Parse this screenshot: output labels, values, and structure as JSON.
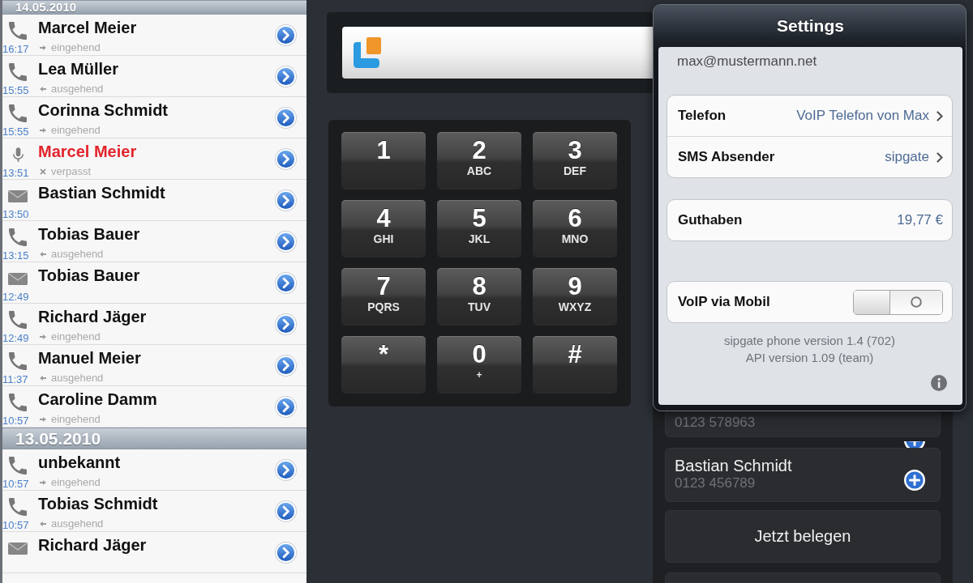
{
  "call_log": {
    "sections": [
      {
        "date": "14.05.2010",
        "entries": [
          {
            "kind": "call",
            "name": "Marcel Meier",
            "time": "16:17",
            "status": {
              "kind": "incoming",
              "text": "eingehend"
            }
          },
          {
            "kind": "call",
            "name": "Lea Müller",
            "time": "15:55",
            "status": {
              "kind": "outgoing",
              "text": "ausgehend"
            }
          },
          {
            "kind": "call",
            "name": "Corinna Schmidt",
            "time": "15:55",
            "status": {
              "kind": "incoming",
              "text": "eingehend"
            }
          },
          {
            "kind": "voicemail",
            "name": "Marcel Meier",
            "time": "13:51",
            "status": {
              "kind": "missed",
              "text": "verpasst"
            }
          },
          {
            "kind": "sms",
            "name": "Bastian Schmidt",
            "time": "13:50"
          },
          {
            "kind": "call",
            "name": "Tobias Bauer",
            "time": "13:15",
            "status": {
              "kind": "outgoing",
              "text": "ausgehend"
            }
          },
          {
            "kind": "sms",
            "name": "Tobias Bauer",
            "time": "12:49"
          },
          {
            "kind": "call",
            "name": "Richard Jäger",
            "time": "12:49",
            "status": {
              "kind": "incoming",
              "text": "eingehend"
            }
          },
          {
            "kind": "call",
            "name": "Manuel Meier",
            "time": "11:37",
            "status": {
              "kind": "outgoing",
              "text": "ausgehend"
            }
          },
          {
            "kind": "call",
            "name": "Caroline Damm",
            "time": "10:57",
            "status": {
              "kind": "incoming",
              "text": "eingehend"
            }
          }
        ]
      },
      {
        "date": "13.05.2010",
        "entries": [
          {
            "kind": "call",
            "name": "unbekannt",
            "time": "10:57",
            "status": {
              "kind": "incoming",
              "text": "eingehend"
            }
          },
          {
            "kind": "call",
            "name": "Tobias Schmidt",
            "time": "10:57",
            "status": {
              "kind": "outgoing",
              "text": "ausgehend"
            }
          },
          {
            "kind": "sms",
            "name": "Richard Jäger"
          }
        ]
      }
    ]
  },
  "keypad": {
    "keys": [
      {
        "digit": "1"
      },
      {
        "digit": "2",
        "letters": "ABC"
      },
      {
        "digit": "3",
        "letters": "DEF"
      },
      {
        "digit": "4",
        "letters": "GHI"
      },
      {
        "digit": "5",
        "letters": "JKL"
      },
      {
        "digit": "6",
        "letters": "MNO"
      },
      {
        "digit": "7",
        "letters": "PQRS"
      },
      {
        "digit": "8",
        "letters": "TUV"
      },
      {
        "digit": "9",
        "letters": "WXYZ"
      },
      {
        "digit": "*"
      },
      {
        "digit": "0",
        "letters": "+"
      },
      {
        "digit": "#"
      }
    ]
  },
  "settings": {
    "title": "Settings",
    "account": "max@mustermann.net",
    "groups": [
      {
        "rows": [
          {
            "kind": "link",
            "label": "Telefon",
            "value": "VoIP Telefon von Max"
          },
          {
            "kind": "link",
            "label": "SMS Absender",
            "value": "sipgate"
          }
        ]
      },
      {
        "rows": [
          {
            "kind": "value",
            "label": "Guthaben",
            "value": "19,77 €"
          }
        ]
      },
      {
        "rows": [
          {
            "kind": "switch",
            "label": "VoIP via Mobil",
            "on": false
          }
        ]
      }
    ],
    "version_lines": [
      "sipgate phone version 1.4 (702)",
      "API version 1.09 (team)"
    ]
  },
  "contacts": [
    {
      "number": "0123 578963"
    },
    {
      "name": "Bastian Schmidt",
      "number": "0123 456789"
    }
  ],
  "buttons": [
    "Jetzt belegen"
  ]
}
